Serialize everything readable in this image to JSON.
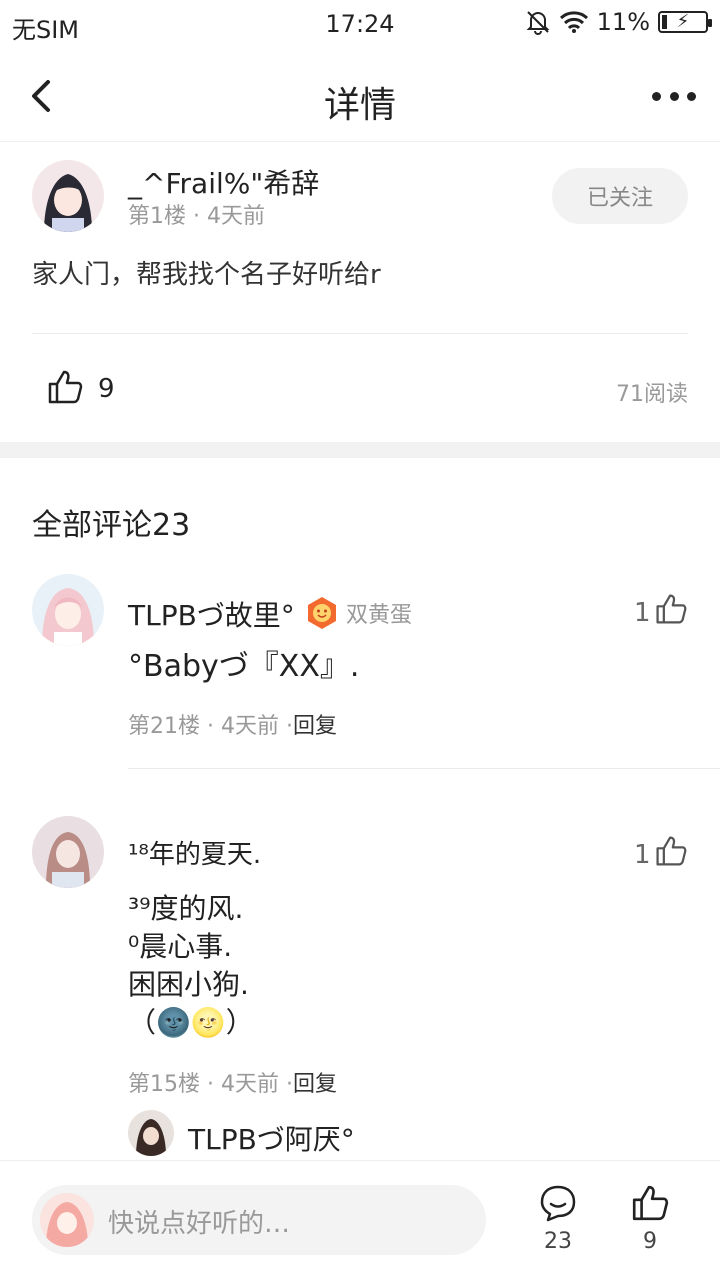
{
  "status_bar": {
    "carrier": "无SIM",
    "time": "17:24",
    "battery_percent": "11%",
    "battery_level": 0.11,
    "icons": [
      "mute-bell-icon",
      "wifi-icon",
      "battery-charging-icon"
    ]
  },
  "nav": {
    "title": "详情",
    "icons": [
      "back-icon",
      "more-icon"
    ]
  },
  "post": {
    "author": "_^Frail%\"希辞",
    "floor": "第1楼",
    "time_ago": "4天前",
    "follow_label": "已关注",
    "content": "家人门，帮我找个名子好听给r",
    "likes": "9",
    "reads": "71阅读"
  },
  "comments_section": {
    "title": "全部评论23",
    "comments": [
      {
        "author": "TLPBづ故里°",
        "badge_label": "双黄蛋",
        "text": "°Babyづ『XX』.",
        "floor": "第21楼",
        "time_ago": "4天前",
        "reply_label": "回复",
        "likes": "1"
      },
      {
        "author": "¹⁸年的夏天.",
        "lines": [
          "³⁹度的风.",
          "⁰晨心事.",
          "困困小狗."
        ],
        "emoji_line": "（🌚🌝）",
        "floor": "第15楼",
        "time_ago": "4天前",
        "reply_label": "回复",
        "likes": "1",
        "sub_reply_author": "TLPBづ阿厌°"
      }
    ]
  },
  "bottom_bar": {
    "input_placeholder": "快说点好听的…",
    "comment_count": "23",
    "like_count": "9"
  },
  "colors": {
    "text_primary": "#222222",
    "text_secondary": "#999999",
    "badge_orange": "#f26a2e",
    "background_gap": "#f2f2f2"
  }
}
